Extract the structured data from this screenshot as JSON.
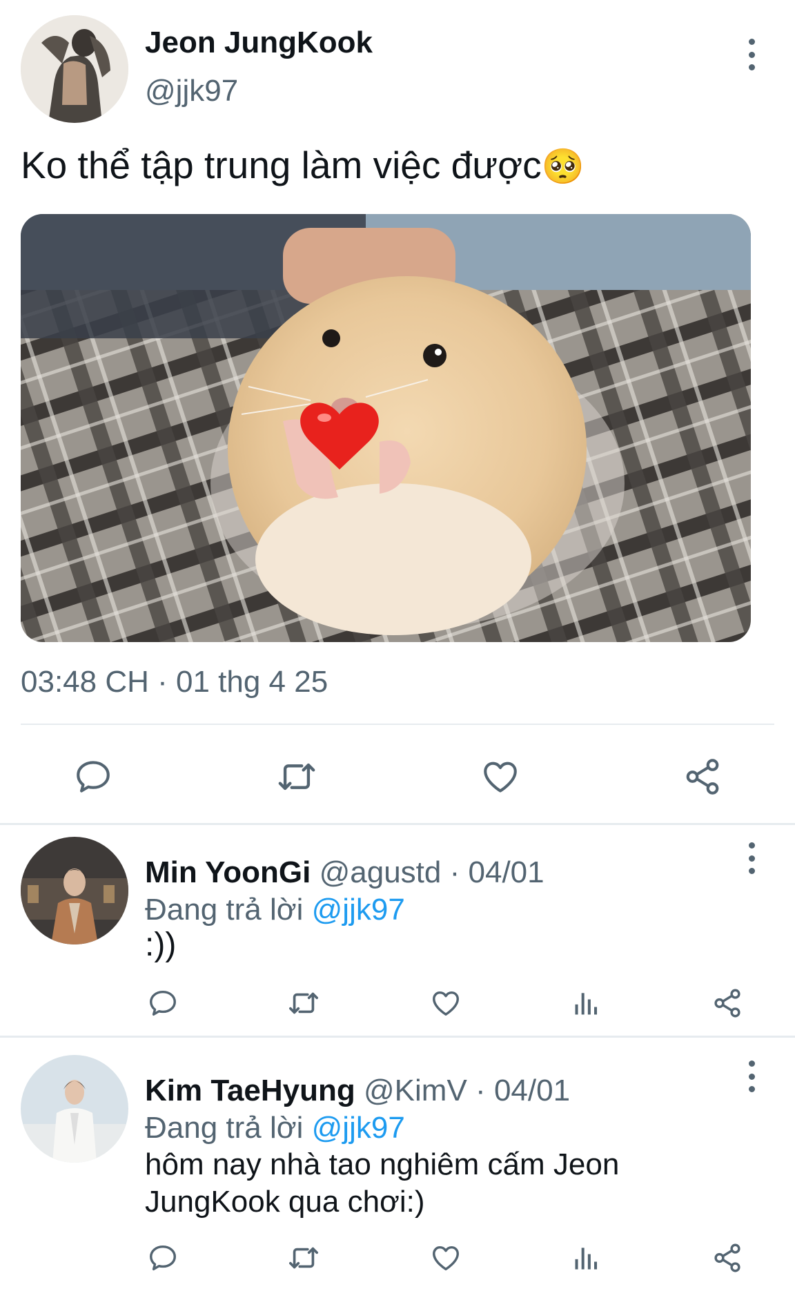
{
  "tweet": {
    "author_name": "Jeon JungKook",
    "author_handle": "@jjk97",
    "text": "Ko thể tập trung làm việc được",
    "emoji": "🥺",
    "photo_emoji": "❤️",
    "timestamp": "03:48 CH · 01 thg 4 25"
  },
  "replies": [
    {
      "name": "Min YoonGi",
      "handle": "@agustd",
      "separator": "·",
      "date": "04/01",
      "replying_prefix": "Đang trả lời",
      "replying_to": "@jjk97",
      "text": ":))"
    },
    {
      "name": "Kim TaeHyung",
      "handle": "@KimV",
      "separator": "·",
      "date": "04/01",
      "replying_prefix": "Đang trả lời",
      "replying_to": "@jjk97",
      "text": "hôm nay nhà tao nghiêm cấm Jeon JungKook qua chơi:)"
    }
  ],
  "icons": {
    "more": "more-vertical-icon",
    "reply": "reply-icon",
    "retweet": "retweet-icon",
    "like": "heart-icon",
    "views": "views-icon",
    "share": "share-icon"
  },
  "colors": {
    "text": "#0f1419",
    "muted": "#536471",
    "link": "#1d9bf0",
    "divider": "#e6ebef"
  }
}
